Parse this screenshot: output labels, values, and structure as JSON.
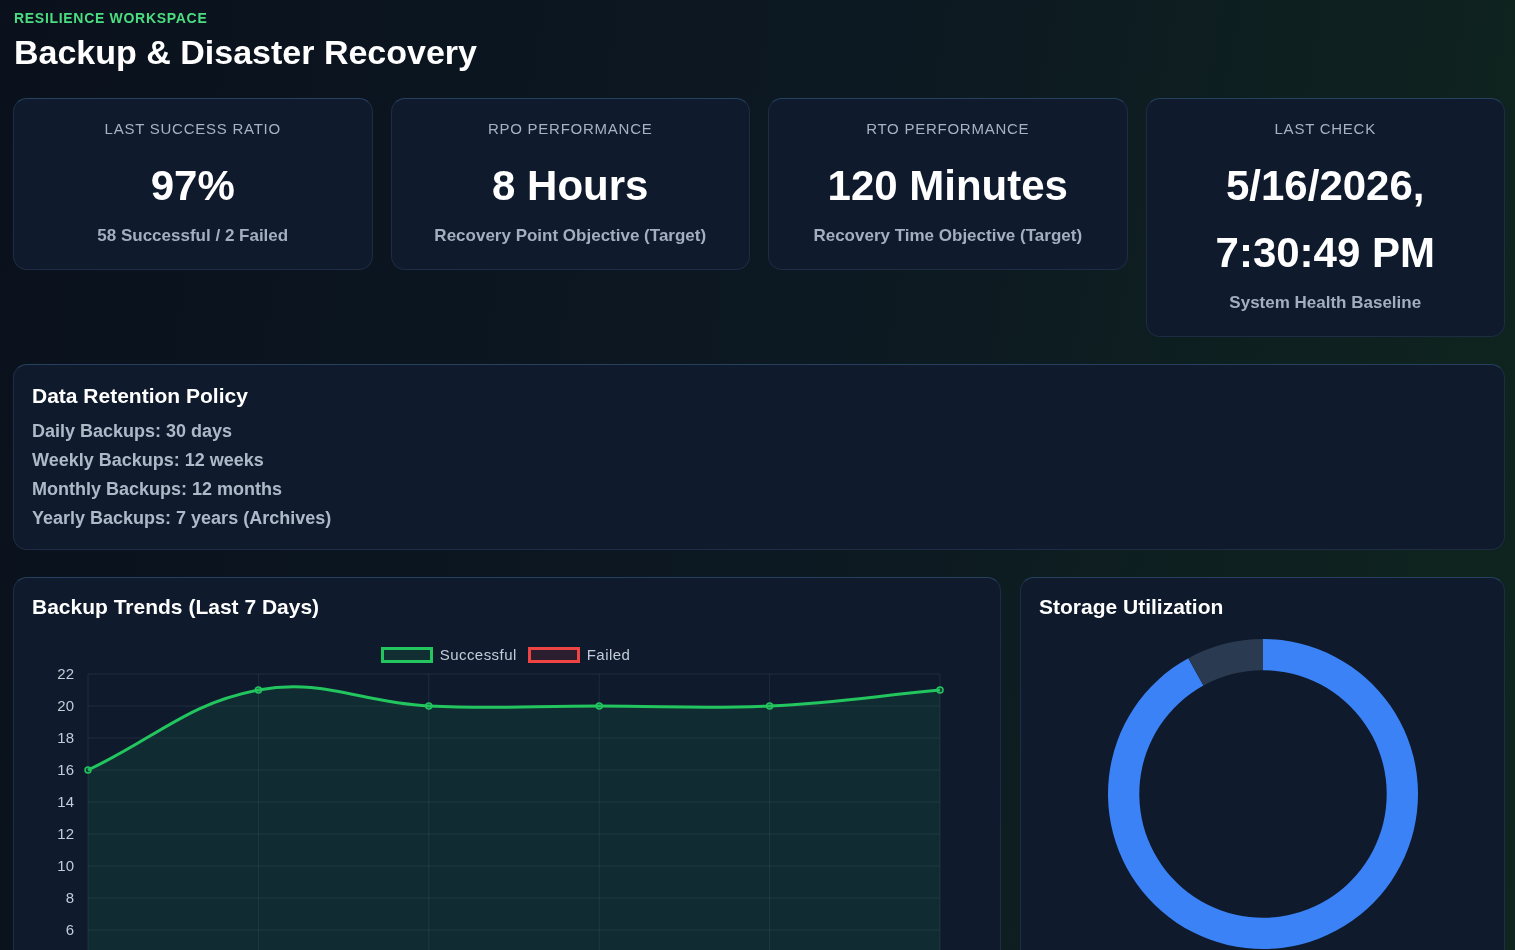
{
  "header": {
    "eyebrow": "RESILIENCE WORKSPACE",
    "title": "Backup & Disaster Recovery"
  },
  "stats": [
    {
      "label": "LAST SUCCESS RATIO",
      "value": "97%",
      "caption": "58 Successful / 2 Failed"
    },
    {
      "label": "RPO PERFORMANCE",
      "value": "8 Hours",
      "caption": "Recovery Point Objective (Target)"
    },
    {
      "label": "RTO PERFORMANCE",
      "value": "120 Minutes",
      "caption": "Recovery Time Objective (Target)"
    },
    {
      "label": "LAST CHECK",
      "value": "5/16/2026, 7:30:49 PM",
      "caption": "System Health Baseline"
    }
  ],
  "retention_policy": {
    "title": "Data Retention Policy",
    "items": [
      "Daily Backups: 30 days",
      "Weekly Backups: 12 weeks",
      "Monthly Backups: 12 months",
      "Yearly Backups: 7 years (Archives)"
    ]
  },
  "backup_trends": {
    "title": "Backup Trends (Last 7 Days)",
    "chart_data": {
      "type": "area",
      "series": [
        {
          "name": "Successful",
          "color": "#22c55e",
          "values": [
            16,
            21,
            20,
            20,
            20,
            21
          ]
        },
        {
          "name": "Failed",
          "color": "#ef4444",
          "values": [
            null,
            null,
            null,
            null,
            null,
            null
          ]
        }
      ],
      "ylim": [
        4.75,
        22
      ],
      "yticks": [
        6,
        8,
        10,
        12,
        14,
        16,
        18,
        20,
        22
      ],
      "grid": true
    }
  },
  "storage_utilization": {
    "title": "Storage Utilization"
  }
}
